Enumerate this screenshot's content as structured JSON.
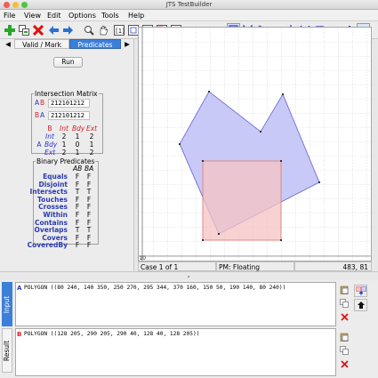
{
  "window": {
    "title": "JTS TestBuilder"
  },
  "menu": [
    "File",
    "View",
    "Edit",
    "Options",
    "Tools",
    "Help"
  ],
  "toolbar": {
    "icons": [
      "new-case-icon",
      "copy-case-icon",
      "delete-case-icon",
      "prev-case-icon",
      "next-case-icon",
      "zoom-icon",
      "pan-icon",
      "zoom-extent-icon",
      "zoom-to-a-icon",
      "zoom-to-b-icon",
      "zoom-to-both-icon",
      "zoom-to-result-icon",
      "draw-polygon-icon",
      "draw-linestring-icon",
      "draw-zigzag-icon",
      "draw-point-icon",
      "edit-vertex-icon",
      "move-vertex-icon",
      "delete-vertex-icon",
      "info-icon",
      "view-icon"
    ]
  },
  "tabs": {
    "prev_arrow": "◀",
    "next_arrow": "▶",
    "validmark": "Valid / Mark",
    "predicates": "Predicates"
  },
  "run_label": "Run",
  "intersection_matrix": {
    "title": "Intersection Matrix",
    "ab_label_a": "A",
    "ab_label_b": "B",
    "ab_value": "212101212",
    "ba_label_b": "B",
    "ba_label_a": "A",
    "ba_value": "212101212",
    "col_b": "B",
    "col_headers": [
      "Int",
      "Bdy",
      "Ext"
    ],
    "row_a": "A",
    "rows": [
      {
        "label": "Int",
        "values": [
          "2",
          "1",
          "2"
        ]
      },
      {
        "label": "Bdy",
        "values": [
          "1",
          "0",
          "1"
        ]
      },
      {
        "label": "Ext",
        "values": [
          "2",
          "1",
          "2"
        ]
      }
    ]
  },
  "binary_predicates": {
    "title": "Binary Predicates",
    "headers": [
      "AB",
      "BA"
    ],
    "rows": [
      {
        "name": "Equals",
        "ab": "F",
        "ba": "F"
      },
      {
        "name": "Disjoint",
        "ab": "F",
        "ba": "F"
      },
      {
        "name": "Intersects",
        "ab": "T",
        "ba": "T"
      },
      {
        "name": "Touches",
        "ab": "F",
        "ba": "F"
      },
      {
        "name": "Crosses",
        "ab": "F",
        "ba": "F"
      },
      {
        "name": "Within",
        "ab": "F",
        "ba": "F"
      },
      {
        "name": "Contains",
        "ab": "F",
        "ba": "F"
      },
      {
        "name": "Overlaps",
        "ab": "T",
        "ba": "T"
      },
      {
        "name": "Covers",
        "ab": "F",
        "ba": "F"
      },
      {
        "name": "CoveredBy",
        "ab": "F",
        "ba": "F"
      }
    ]
  },
  "canvas": {
    "scale_label": "10",
    "polygon_a_fill": "#c9c9f7",
    "polygon_a_stroke": "#7a7ad8",
    "polygon_b_fill": "#f6c3c3",
    "polygon_b_stroke": "#d88a8a"
  },
  "status": {
    "case": "Case 1 of 1",
    "pm": "PM: Floating",
    "coords": "483, 81"
  },
  "bottom": {
    "tab_input": "Input",
    "tab_result": "Result",
    "geom_a_letter": "A",
    "geom_a_wkt": "POLYGON ((80 240, 140 350, 250 270, 295 344, 370 160, 150 50, 190 140, 80 240))",
    "geom_b_letter": "B",
    "geom_b_wkt": "POLYGON ((128 205, 290 205, 290 40, 128 40, 128 205))"
  },
  "colors": {
    "accent": "#3b7fd9",
    "a_color": "#2b35c9",
    "b_color": "#d62020"
  }
}
